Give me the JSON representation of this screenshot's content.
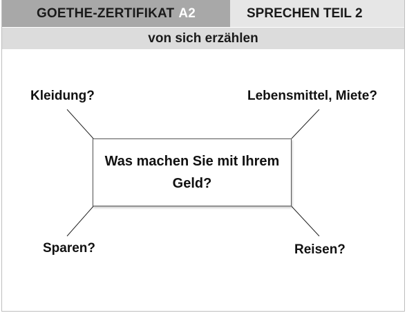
{
  "header": {
    "exam": "GOETHE-ZERTIFIKAT",
    "level": "A2",
    "section": "SPRECHEN TEIL 2"
  },
  "subheader": "von sich erzählen",
  "question": "Was machen Sie mit Ihrem Geld?",
  "keywords": {
    "top_left": "Kleidung?",
    "top_right": "Lebensmittel, Miete?",
    "bottom_left": "Sparen?",
    "bottom_right": "Reisen?"
  }
}
